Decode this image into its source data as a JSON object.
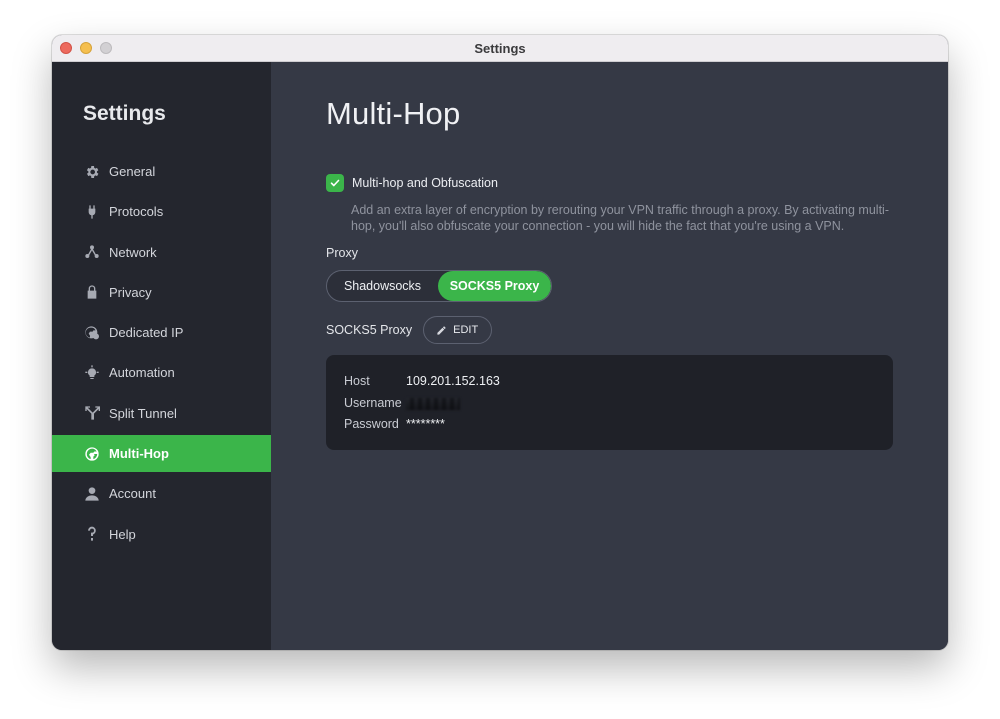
{
  "window": {
    "title": "Settings"
  },
  "sidebar": {
    "heading": "Settings",
    "items": [
      {
        "label": "General",
        "icon": "gear-icon"
      },
      {
        "label": "Protocols",
        "icon": "plug-icon"
      },
      {
        "label": "Network",
        "icon": "network-icon"
      },
      {
        "label": "Privacy",
        "icon": "lock-icon"
      },
      {
        "label": "Dedicated IP",
        "icon": "globe-pin-icon"
      },
      {
        "label": "Automation",
        "icon": "lightbulb-icon"
      },
      {
        "label": "Split Tunnel",
        "icon": "split-icon"
      },
      {
        "label": "Multi-Hop",
        "icon": "globe-icon",
        "active": true
      },
      {
        "label": "Account",
        "icon": "user-icon"
      },
      {
        "label": "Help",
        "icon": "question-icon"
      }
    ]
  },
  "main": {
    "title": "Multi-Hop",
    "toggle": {
      "label": "Multi-hop and Obfuscation",
      "checked": true
    },
    "description": "Add an extra layer of encryption by rerouting your VPN traffic through a proxy. By activating multi-hop, you'll also obfuscate your connection - you will hide the fact that you're using a VPN.",
    "proxy_label": "Proxy",
    "proxy_options": {
      "shadowsocks": "Shadowsocks",
      "socks5": "SOCKS5 Proxy",
      "selected": "SOCKS5 Proxy"
    },
    "socks_label": "SOCKS5 Proxy",
    "edit_label": "EDIT",
    "details": {
      "host_key": "Host",
      "host_value": "109.201.152.163",
      "username_key": "Username",
      "password_key": "Password",
      "password_value": "********"
    }
  },
  "colors": {
    "accent": "#3bb54a",
    "sidebar_bg": "#24262e",
    "main_bg": "#353945",
    "card_bg": "#1f2128"
  }
}
